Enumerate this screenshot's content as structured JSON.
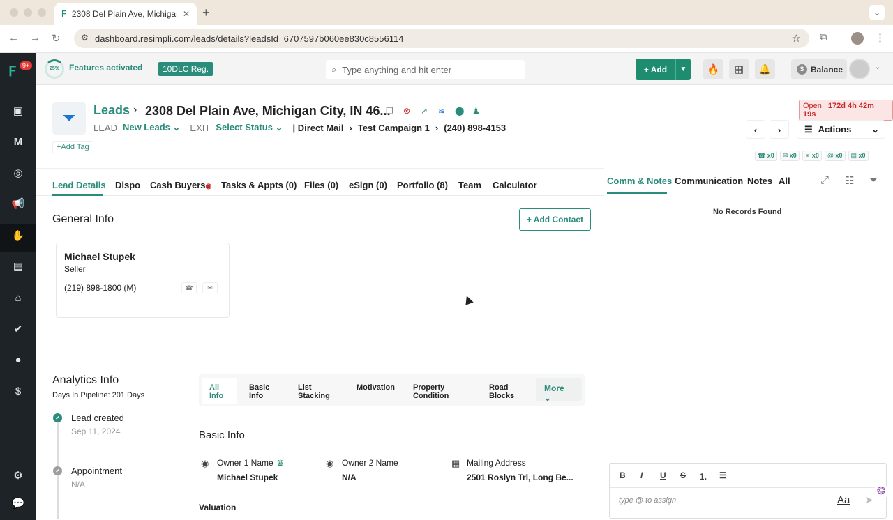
{
  "browser": {
    "tab_title": "2308 Del Plain Ave, Michigan",
    "url": "dashboard.resimpli.com/leads/details?leadsId=6707597b060ee830c8556114"
  },
  "sidebar": {
    "badge": "9+",
    "items": [
      "inbox-icon",
      "m-logo-icon",
      "target-icon",
      "megaphone-icon",
      "leads-icon",
      "buildings-icon",
      "home-icon",
      "check-icon",
      "user-icon",
      "dollar-icon",
      "settings-icon",
      "chat-icon"
    ]
  },
  "topbar": {
    "progress": "25%",
    "features_label": "Features activated",
    "dlc_label": "10DLC Reg.",
    "search_placeholder": "Type anything and hit enter",
    "add_label": "Add",
    "balance_label": "Balance"
  },
  "lead": {
    "crumb_leads": "Leads",
    "address": "2308 Del Plain Ave, Michigan City, IN 46...",
    "lead_label": "LEAD",
    "lead_status": "New Leads",
    "exit_label": "EXIT",
    "exit_status": "Select Status",
    "source": "| Direct Mail",
    "campaign": "Test Campaign 1",
    "phone": "(240) 898-4153",
    "add_tag": "+Add Tag",
    "timer_status": "Open",
    "timer_value": "172d 4h 42m 19s",
    "actions_label": "Actions",
    "counters": [
      "x0",
      "x0",
      "x0",
      "x0",
      "x0"
    ]
  },
  "tabs": {
    "left": [
      "Lead Details",
      "Dispo",
      "Cash Buyers",
      "Tasks & Appts (0)",
      "Files (0)",
      "eSign (0)",
      "Portfolio (8)",
      "Team",
      "Calculator"
    ],
    "right": [
      "Comm & Notes",
      "Communication",
      "Notes",
      "All"
    ]
  },
  "right_panel": {
    "empty_text": "No Records Found",
    "editor_placeholder": "type @ to assign",
    "aa_label": "Aa"
  },
  "general": {
    "title": "General Info",
    "add_contact": "+ Add Contact",
    "contact_name": "Michael Stupek",
    "contact_role": "Seller",
    "contact_phone": "(219) 898-1800  (M)"
  },
  "analytics": {
    "title": "Analytics Info",
    "days": "Days In Pipeline: 201 Days",
    "timeline": [
      {
        "title": "Lead created",
        "sub": "Sep 11, 2024"
      },
      {
        "title": "Appointment",
        "sub": "N/A"
      }
    ],
    "tabs": [
      "All Info",
      "Basic Info",
      "List Stacking",
      "Motivation",
      "Property Condition",
      "Road Blocks"
    ],
    "more_label": "More"
  },
  "basic": {
    "title": "Basic Info",
    "owner1_label": "Owner 1 Name",
    "owner1_value": "Michael Stupek",
    "owner2_label": "Owner 2 Name",
    "owner2_value": "N/A",
    "mailing_label": "Mailing Address",
    "mailing_value": "2501 Roslyn Trl, Long Be...",
    "valuation_label": "Valuation"
  },
  "colors": {
    "brand": "#2a8c7b",
    "sidebar": "#1e2328",
    "add_button": "#1e8c6e"
  }
}
